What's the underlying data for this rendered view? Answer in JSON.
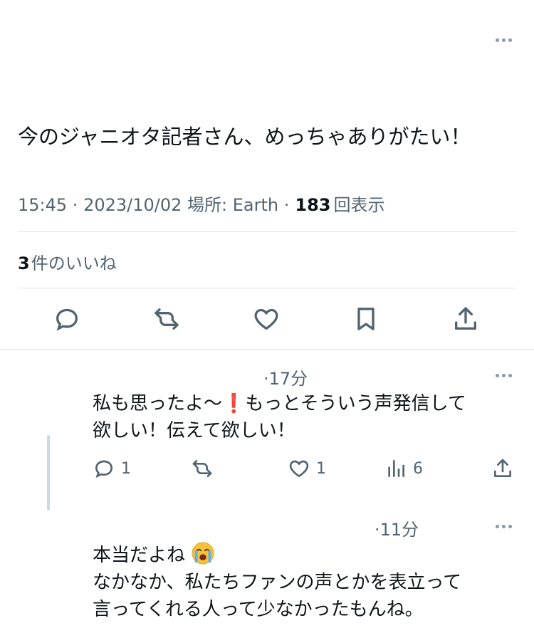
{
  "tweet": {
    "text": "今のジャニオタ記者さん、めっちゃありがたい！",
    "time": "15:45",
    "date": "2023/10/02",
    "location_label": "場所: Earth",
    "views_count": "183",
    "views_label": "回表示",
    "likes_count": "3",
    "likes_label": "件のいいね"
  },
  "actions": {
    "reply_icon": "reply-icon",
    "retweet_icon": "retweet-icon",
    "like_icon": "heart-icon",
    "bookmark_icon": "bookmark-icon",
    "share_icon": "share-icon"
  },
  "replies": [
    {
      "time": "17分",
      "lines": [
        "私も思ったよ〜",
        "もっとそういう声発信して",
        "欲しい！伝えて欲しい！"
      ],
      "reply_count": "1",
      "like_count": "1",
      "view_count": "6"
    },
    {
      "time": "11分",
      "lines": [
        "本当だよね",
        "なかなか、私たちファンの声とかを表立って",
        "言ってくれる人って少なかったもんね。"
      ]
    }
  ],
  "colors": {
    "text": "#0f1419",
    "secondary": "#536471",
    "divider": "#e1e4e8",
    "exclamation": "#d0021b"
  }
}
